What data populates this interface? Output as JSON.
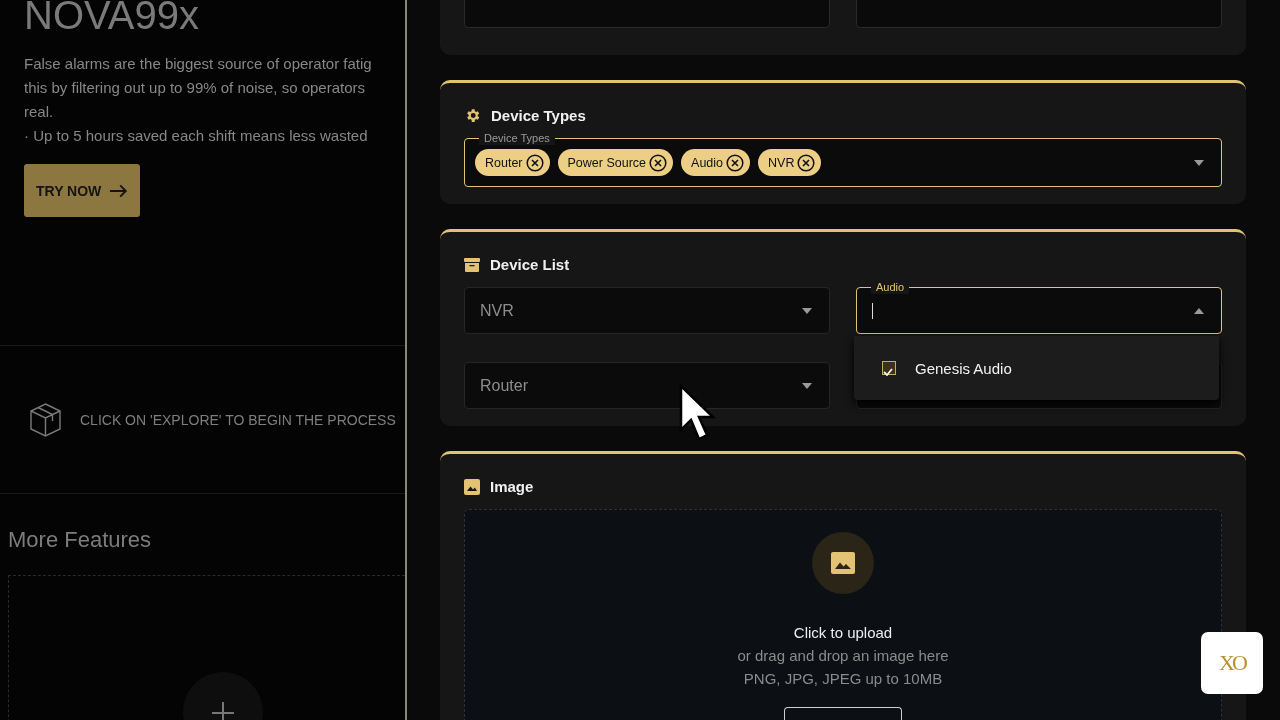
{
  "hero": {
    "title": "NOVA99x",
    "description_lines": [
      "False alarms are the biggest source of operator fatig",
      "this by filtering out up to 99% of noise, so operators",
      "real.",
      "· Up to 5 hours saved each shift means less wasted"
    ],
    "cta": "TRY NOW"
  },
  "hint": "CLICK ON 'EXPLORE' TO BEGIN THE PROCESS",
  "more_features": {
    "title": "More Features"
  },
  "device_types": {
    "title": "Device Types",
    "field_label": "Device Types",
    "chips": [
      "Router",
      "Power Source",
      "Audio",
      "NVR"
    ]
  },
  "device_list": {
    "title": "Device List",
    "selects": [
      {
        "value": "NVR",
        "open": false
      },
      {
        "label": "Audio",
        "open": true
      },
      {
        "value": "Router",
        "open": false
      }
    ],
    "options": [
      {
        "label": "Genesis Audio",
        "checked": true
      }
    ]
  },
  "image": {
    "title": "Image",
    "upload_title": "Click to upload",
    "upload_hint": "or drag and drop an image here",
    "upload_formats": "PNG, JPG, JPEG up to 10MB"
  },
  "badge": "XO"
}
